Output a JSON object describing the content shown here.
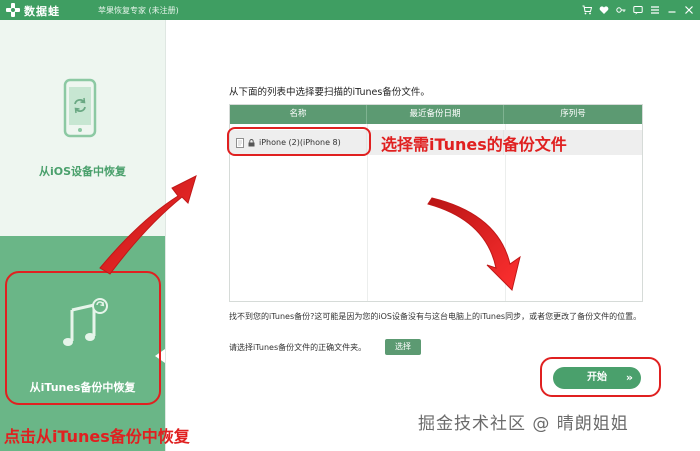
{
  "titlebar": {
    "app_name": "数据蛙",
    "app_subtitle": "苹果恢复专家 (未注册)",
    "controls": [
      "cart-icon",
      "heart-icon",
      "key-icon",
      "message-icon",
      "menu-icon",
      "minimize-icon",
      "close-icon"
    ]
  },
  "sidebar": {
    "items": [
      {
        "label": "从iOS设备中恢复",
        "icon": "phone-restore-icon",
        "active": false
      },
      {
        "label": "从iTunes备份中恢复",
        "icon": "music-note-icon",
        "active": true
      }
    ]
  },
  "main": {
    "instruction": "从下面的列表中选择要扫描的iTunes备份文件。",
    "table": {
      "columns": [
        "名称",
        "最近备份日期",
        "序列号"
      ],
      "rows": [
        {
          "name": "iPhone (2)(iPhone 8)",
          "date": "",
          "serial": ""
        }
      ]
    },
    "note": "找不到您的iTunes备份?这可能是因为您的iOS设备没有与这台电脑上的iTunes同步，或者您更改了备份文件的位置。",
    "choose_label": "请选择iTunes备份文件的正确文件夹。",
    "choose_button": "选择",
    "start_button": "开始",
    "start_arrows": "»"
  },
  "annotations": {
    "callout_top": "选择需iTunes的备份文件",
    "callout_bottom": "点击从iTunes备份中恢复",
    "watermark": "掘金技术社区 @ 晴朗姐姐"
  },
  "colors": {
    "brand_green": "#3f9e62",
    "active_sidebar": "#6ab687",
    "header_green": "#5c9a72",
    "annotation_red": "#e02020"
  }
}
